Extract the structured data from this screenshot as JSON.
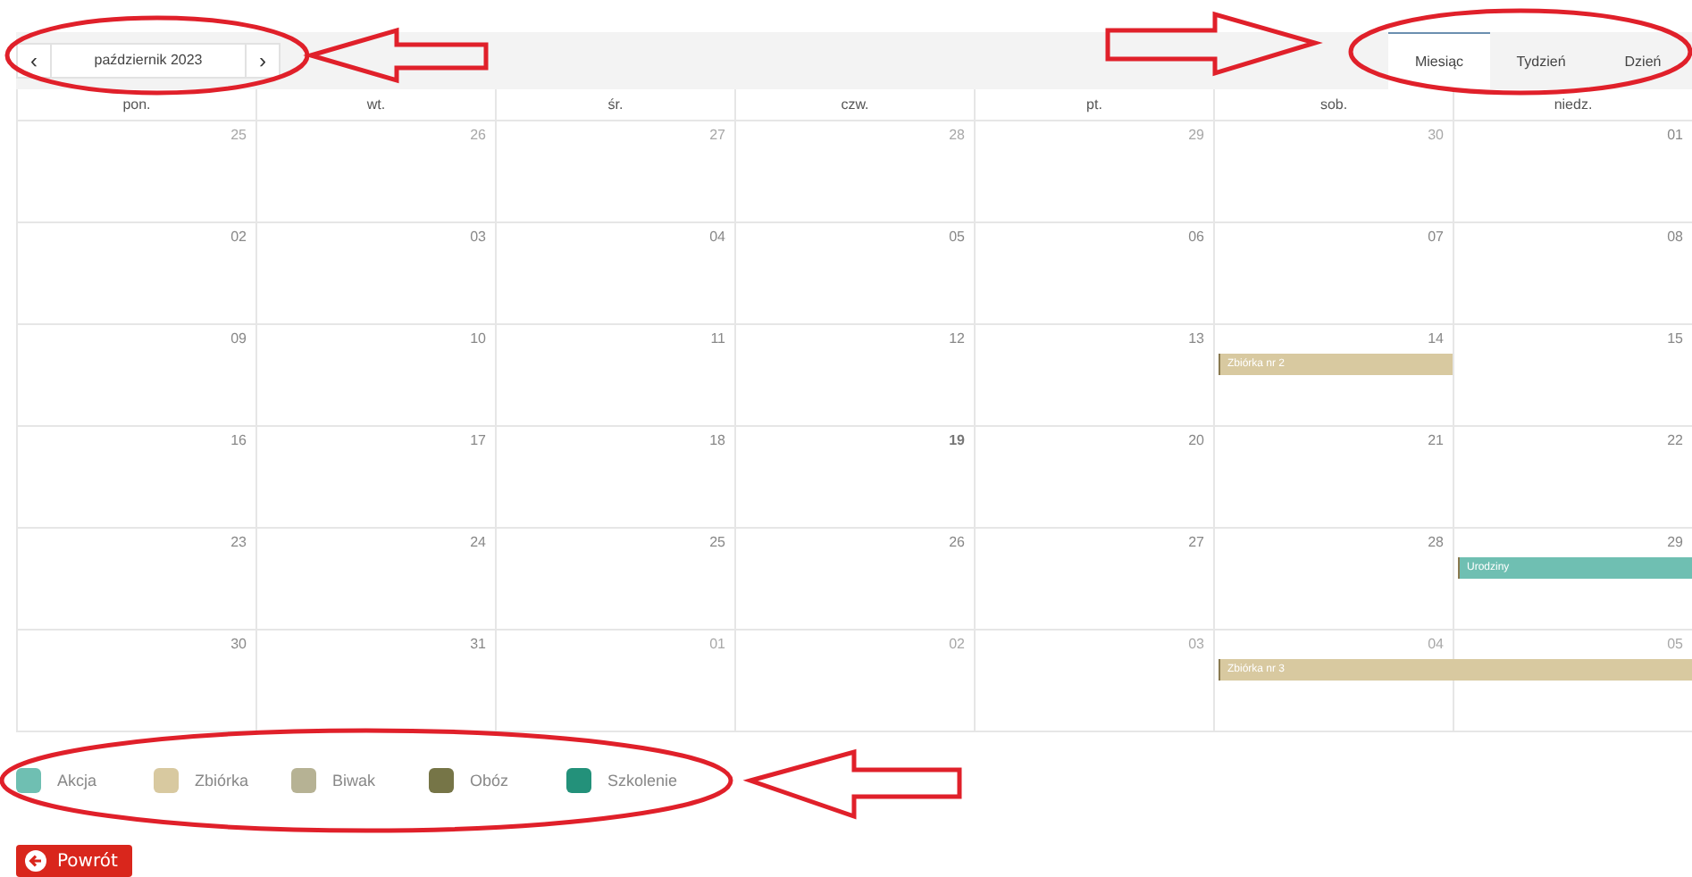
{
  "toolbar": {
    "prev": "‹",
    "title": "październik 2023",
    "next": "›",
    "views": [
      {
        "label": "Miesiąc",
        "selected": true
      },
      {
        "label": "Tydzień",
        "selected": false
      },
      {
        "label": "Dzień",
        "selected": false
      }
    ]
  },
  "weekdays": [
    "pon.",
    "wt.",
    "śr.",
    "czw.",
    "pt.",
    "sob.",
    "niedz."
  ],
  "weeks": [
    [
      {
        "label": "25",
        "other_month": true
      },
      {
        "label": "26",
        "other_month": true
      },
      {
        "label": "27",
        "other_month": true
      },
      {
        "label": "28",
        "other_month": true
      },
      {
        "label": "29",
        "other_month": true
      },
      {
        "label": "30",
        "other_month": true
      },
      {
        "label": "01",
        "other_month": false
      }
    ],
    [
      {
        "label": "02",
        "other_month": false
      },
      {
        "label": "03",
        "other_month": false
      },
      {
        "label": "04",
        "other_month": false
      },
      {
        "label": "05",
        "other_month": false
      },
      {
        "label": "06",
        "other_month": false
      },
      {
        "label": "07",
        "other_month": false
      },
      {
        "label": "08",
        "other_month": false
      }
    ],
    [
      {
        "label": "09",
        "other_month": false
      },
      {
        "label": "10",
        "other_month": false
      },
      {
        "label": "11",
        "other_month": false
      },
      {
        "label": "12",
        "other_month": false
      },
      {
        "label": "13",
        "other_month": false
      },
      {
        "label": "14",
        "other_month": false,
        "events": [
          {
            "title": "Zbiórka nr 2",
            "color": "#d8c9a0",
            "continues": false
          }
        ]
      },
      {
        "label": "15",
        "other_month": false
      }
    ],
    [
      {
        "label": "16",
        "other_month": false
      },
      {
        "label": "17",
        "other_month": false
      },
      {
        "label": "18",
        "other_month": false
      },
      {
        "label": "19",
        "other_month": false,
        "today": true
      },
      {
        "label": "20",
        "other_month": false
      },
      {
        "label": "21",
        "other_month": false
      },
      {
        "label": "22",
        "other_month": false
      }
    ],
    [
      {
        "label": "23",
        "other_month": false
      },
      {
        "label": "24",
        "other_month": false
      },
      {
        "label": "25",
        "other_month": false
      },
      {
        "label": "26",
        "other_month": false
      },
      {
        "label": "27",
        "other_month": false
      },
      {
        "label": "28",
        "other_month": false
      },
      {
        "label": "29",
        "other_month": false,
        "events": [
          {
            "title": "Urodziny",
            "color": "#6fbfb2"
          }
        ]
      }
    ],
    [
      {
        "label": "30",
        "other_month": false
      },
      {
        "label": "31",
        "other_month": false
      },
      {
        "label": "01",
        "other_month": true
      },
      {
        "label": "02",
        "other_month": true
      },
      {
        "label": "03",
        "other_month": true
      },
      {
        "label": "04",
        "other_month": true,
        "events": [
          {
            "title": "Zbiórka nr 3",
            "color": "#d8c9a0",
            "continues": true
          }
        ]
      },
      {
        "label": "05",
        "other_month": true
      }
    ]
  ],
  "legend": [
    {
      "label": "Akcja",
      "color": "#6fbfb2"
    },
    {
      "label": "Zbiórka",
      "color": "#d8c9a0"
    },
    {
      "label": "Biwak",
      "color": "#b6b294"
    },
    {
      "label": "Obóz",
      "color": "#767547"
    },
    {
      "label": "Szkolenie",
      "color": "#23917a"
    }
  ],
  "back_button": {
    "label": "Powrót"
  }
}
